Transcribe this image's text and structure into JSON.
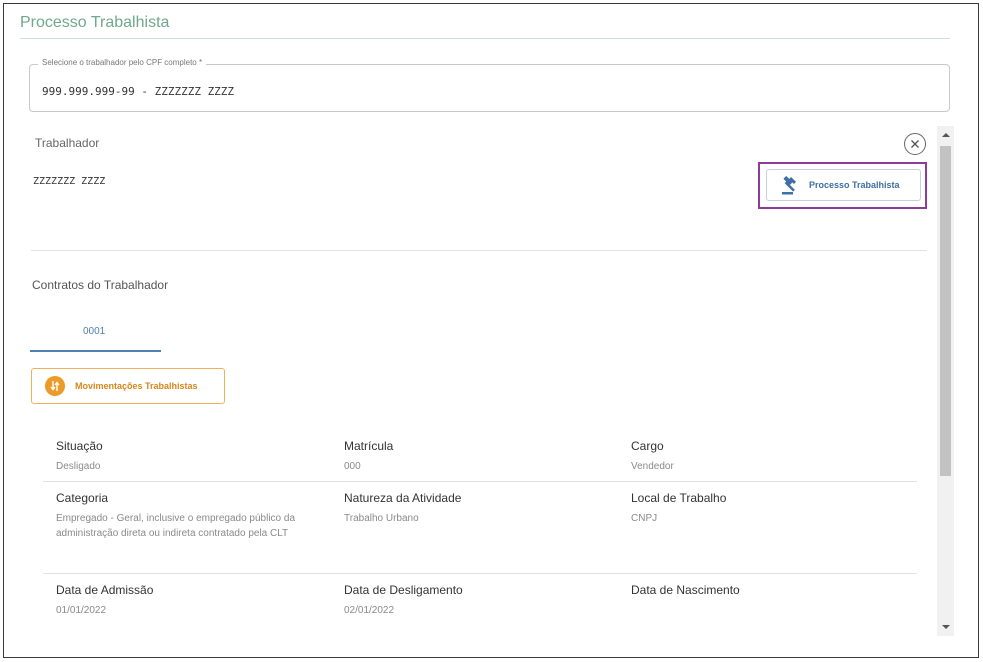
{
  "page": {
    "title": "Processo Trabalhista"
  },
  "cpf": {
    "label": "Selecione o trabalhador pelo CPF completo *",
    "value": "999.999.999-99 - ZZZZZZZ ZZZZ"
  },
  "worker": {
    "label": "Trabalhador",
    "name": "ZZZZZZZ ZZZZ"
  },
  "actions": {
    "processo_label": "Processo Trabalhista",
    "movimentacoes_label": "Movimentações Trabalhistas"
  },
  "contracts": {
    "label": "Contratos do Trabalhador",
    "tabs": [
      {
        "label": "0001"
      }
    ]
  },
  "details": {
    "rows": [
      [
        {
          "label": "Situação",
          "value": "Desligado"
        },
        {
          "label": "Matrícula",
          "value": "000"
        },
        {
          "label": "Cargo",
          "value": "Vendedor"
        }
      ],
      [
        {
          "label": "Categoria",
          "value": "Empregado - Geral, inclusive o empregado público da administração direta ou indireta contratado pela CLT"
        },
        {
          "label": "Natureza da Atividade",
          "value": "Trabalho Urbano"
        },
        {
          "label": "Local de Trabalho",
          "value": "CNPJ"
        }
      ],
      [
        {
          "label": "Data de Admissão",
          "value": "01/01/2022"
        },
        {
          "label": "Data de Desligamento",
          "value": "02/01/2022"
        },
        {
          "label": "Data de Nascimento",
          "value": ""
        }
      ]
    ]
  },
  "icons": {
    "close": "close-icon",
    "processo": "gavel-icon",
    "movimentacoes": "transfer-icon",
    "scroll_up": "chevron-up-icon",
    "scroll_down": "chevron-down-icon"
  },
  "colors": {
    "title_green": "#6fa88e",
    "highlight_purple": "#8e3b9a",
    "processo_blue": "#3f6fa8",
    "tab_blue": "#4e80b0",
    "movimentacoes_orange": "#ec9a2a"
  }
}
